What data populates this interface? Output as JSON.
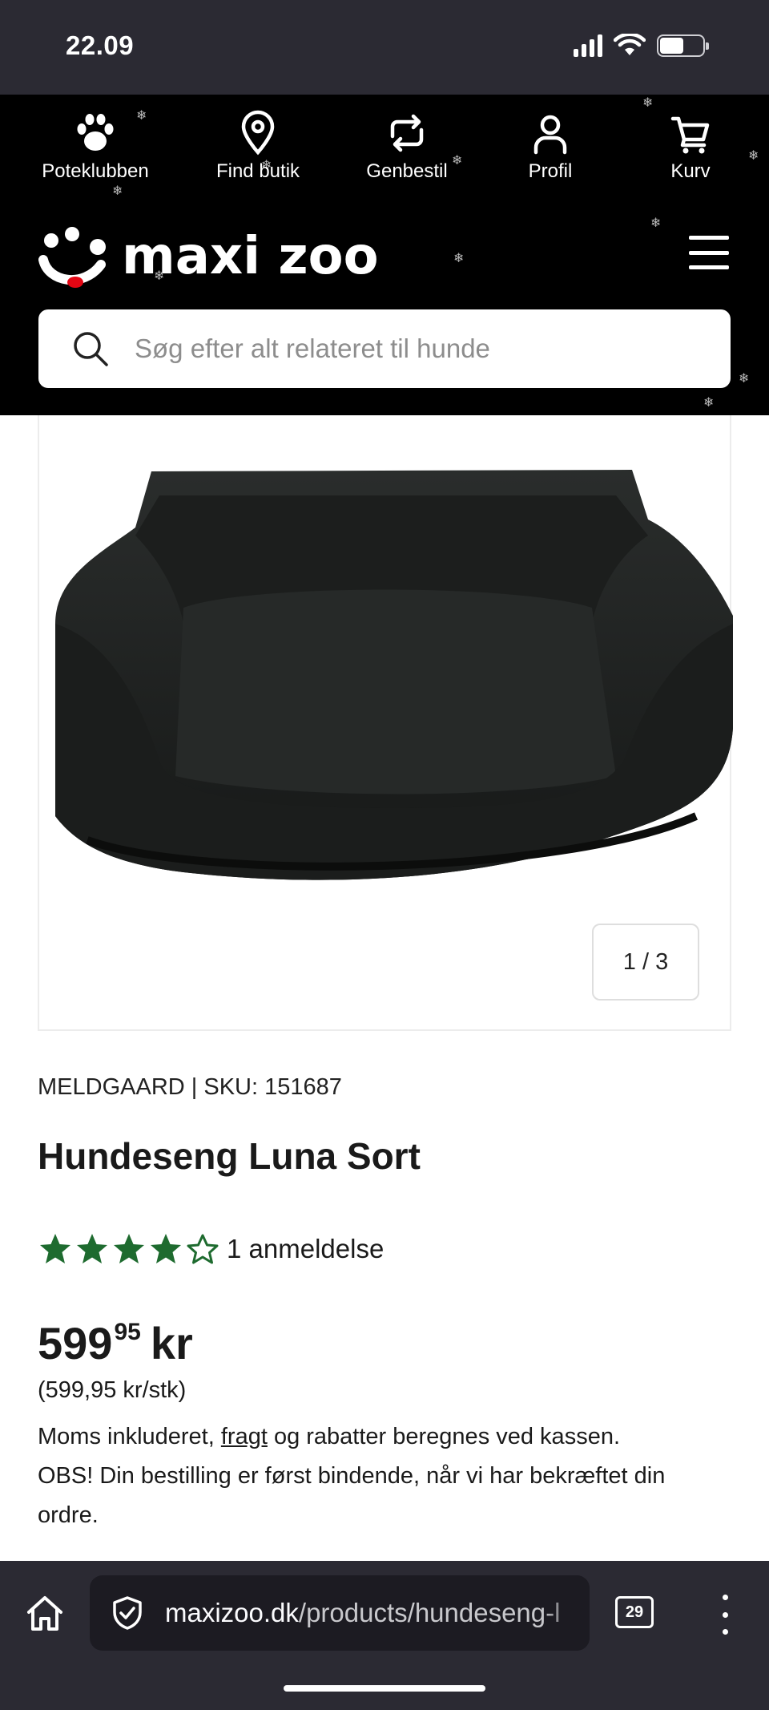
{
  "status_bar": {
    "time": "22.09",
    "battery_level": 0.55
  },
  "top_nav": {
    "items": [
      {
        "label": "Poteklubben",
        "icon": "paw-icon"
      },
      {
        "label": "Find butik",
        "icon": "location-pin-icon"
      },
      {
        "label": "Genbestil",
        "icon": "repeat-icon"
      },
      {
        "label": "Profil",
        "icon": "user-icon"
      },
      {
        "label": "Kurv",
        "icon": "cart-icon"
      }
    ]
  },
  "header": {
    "logo_text": "maxi zoo",
    "search_placeholder": "Søg efter alt relateret til hunde"
  },
  "gallery": {
    "counter": "1 / 3"
  },
  "product": {
    "brand_sku": "MELDGAARD | SKU: 151687",
    "title": "Hundeseng Luna Sort",
    "rating": 4,
    "rating_max": 5,
    "review_text": "1 anmeldelse",
    "price_main": "599",
    "price_cents": "95",
    "price_currency": "kr",
    "unit_price": "(599,95 kr/stk)",
    "note_before_link": "Moms inkluderet, ",
    "note_link": "fragt",
    "note_after_link": " og rabatter beregnes ved kassen.",
    "note_obs": "OBS! Din bestilling er først bindende, når vi har bekræftet din ordre."
  },
  "browser": {
    "url_domain": "maxizoo.dk",
    "url_path": "/products/hundeseng-l",
    "tab_count": "29"
  },
  "colors": {
    "header_bg": "#000000",
    "star_green": "#1e6b2f",
    "browser_bg": "#2b2a33"
  }
}
